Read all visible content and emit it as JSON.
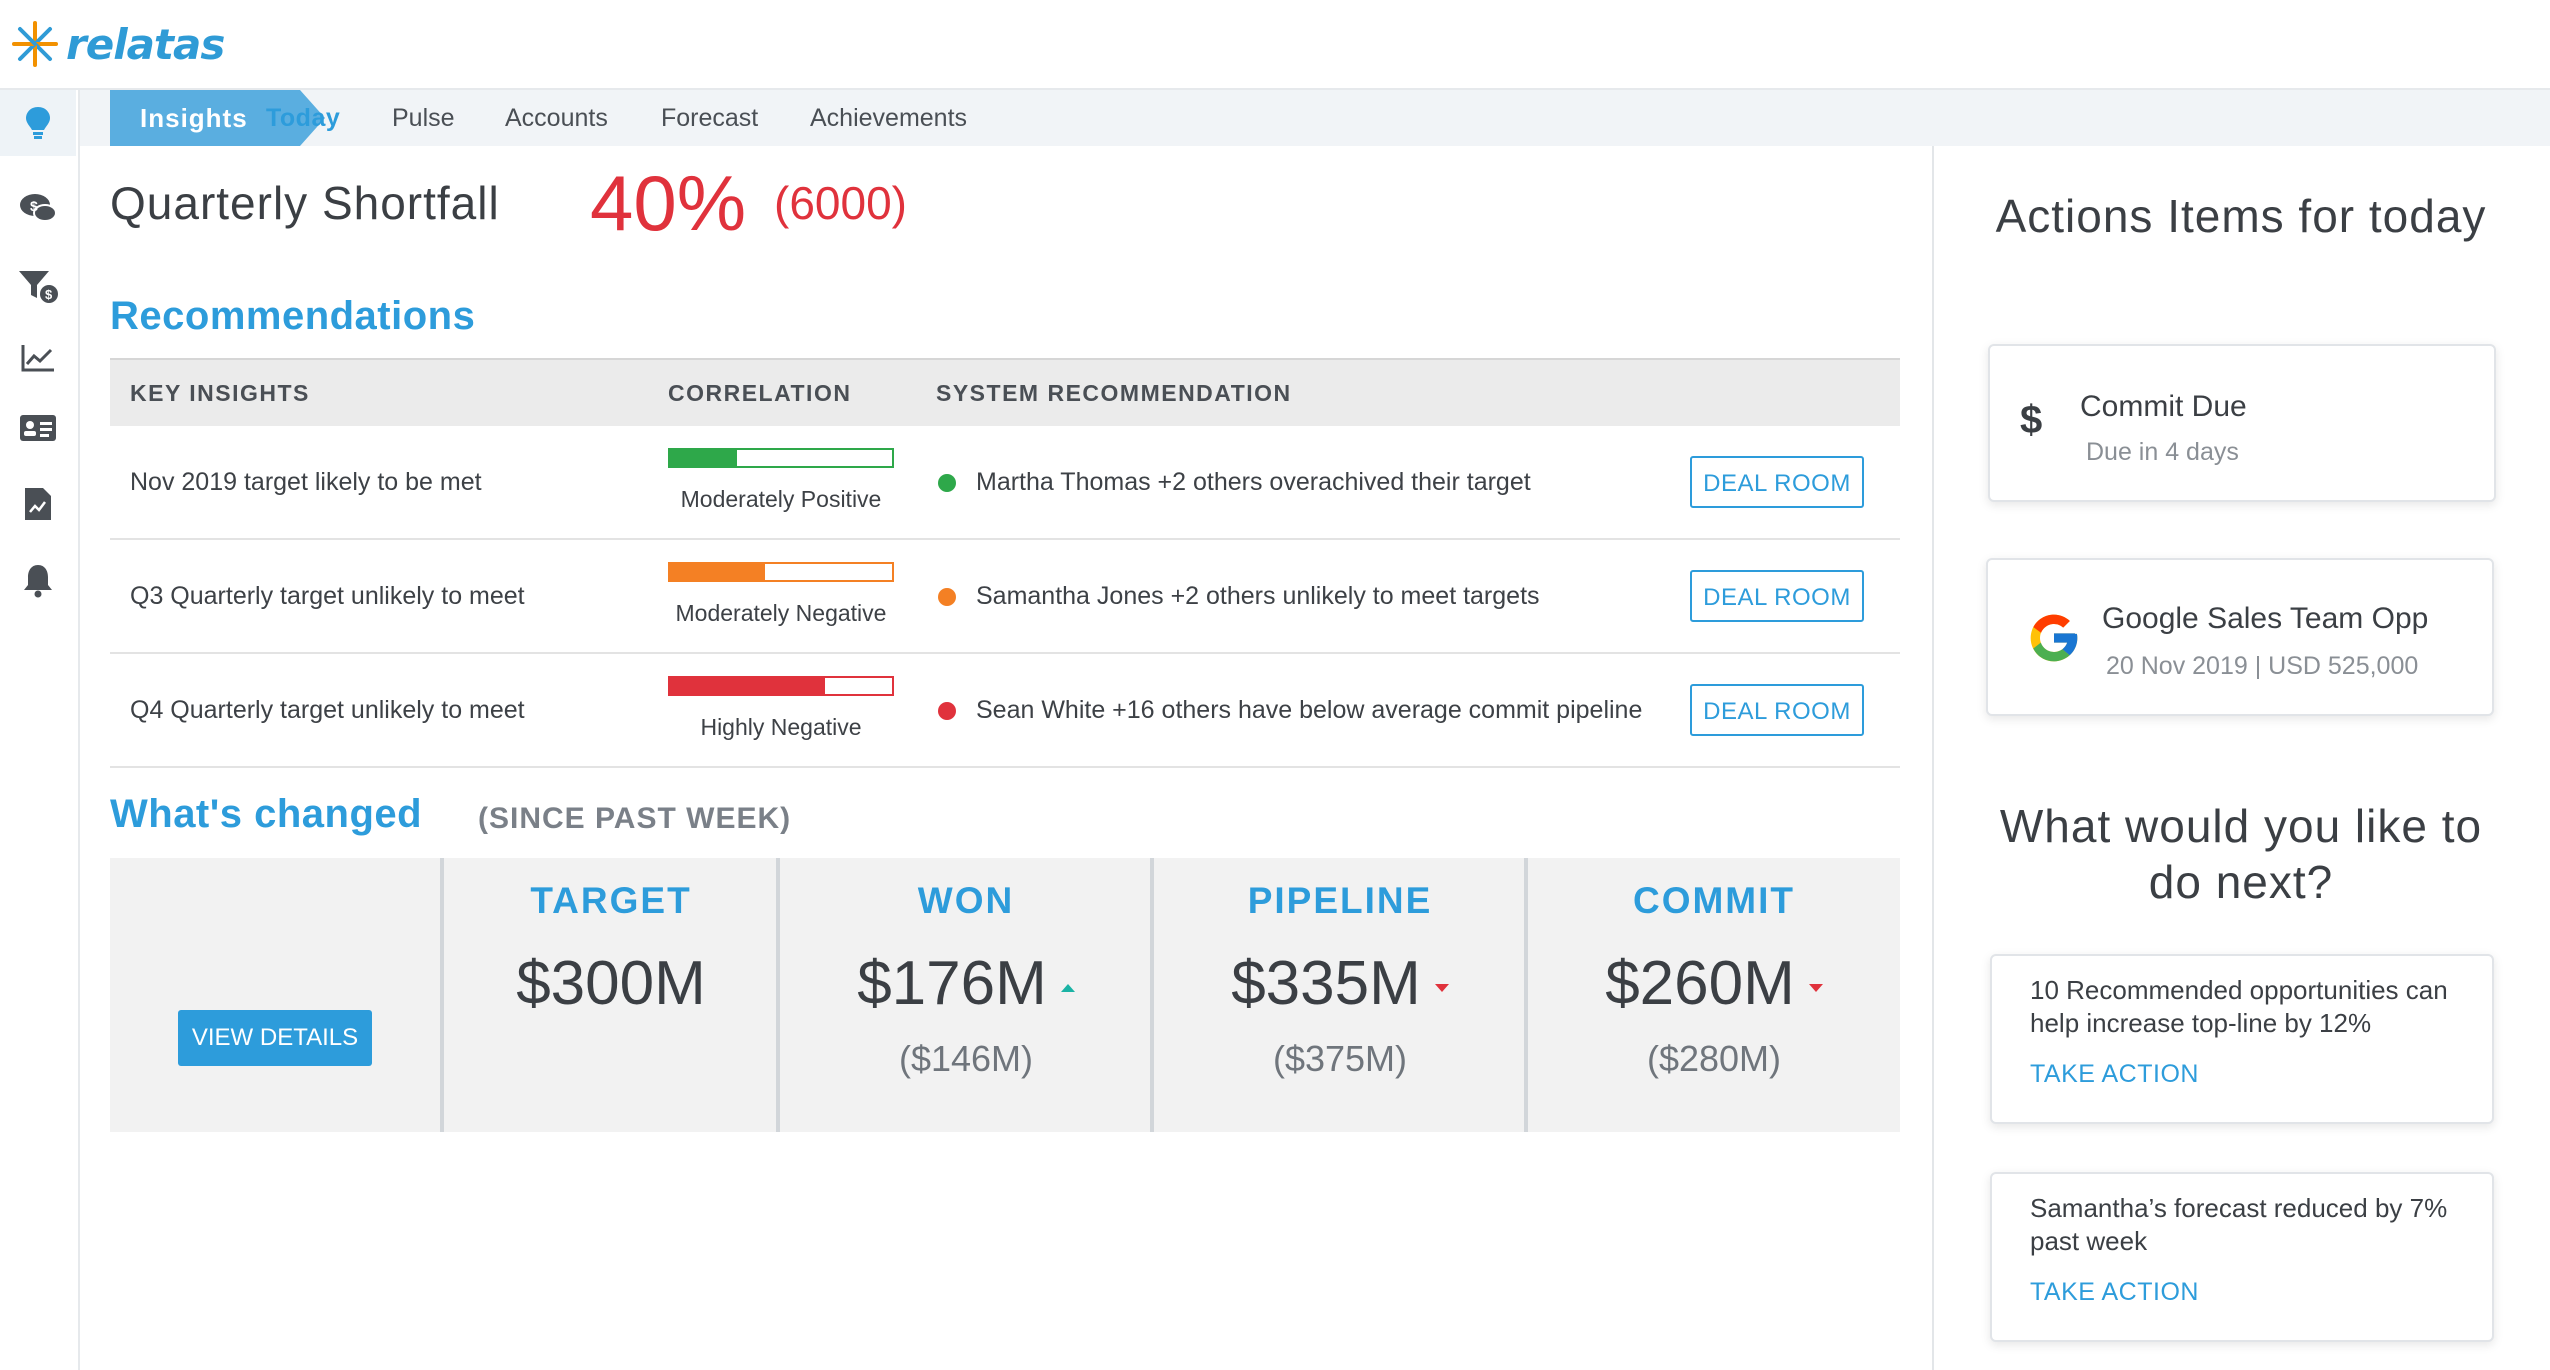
{
  "app": {
    "logo_text": "relatas"
  },
  "tabs": {
    "active_section": "Insights",
    "items": [
      "Today",
      "Pulse",
      "Accounts",
      "Forecast",
      "Achievements"
    ]
  },
  "sidebar": {
    "icons": [
      "lightbulb-icon",
      "chat-dollar-icon",
      "funnel-dollar-icon",
      "line-chart-icon",
      "contact-card-icon",
      "report-icon",
      "bell-icon"
    ]
  },
  "shortfall": {
    "label": "Quarterly Shortfall",
    "percent": "40%",
    "amount": "(6000)"
  },
  "recommendations": {
    "title": "Recommendations",
    "headers": {
      "insights": "KEY INSIGHTS",
      "correlation": "CORRELATION",
      "system": "SYSTEM RECOMMENDATION"
    },
    "rows": [
      {
        "insight": "Nov 2019 target likely to be met",
        "correlation_label": "Moderately Positive",
        "correlation_level": 0.3,
        "color": "#2ea84a",
        "recommendation": "Martha Thomas +2 others overachived their target",
        "button": "DEAL ROOM"
      },
      {
        "insight": "Q3 Quarterly target unlikely to meet",
        "correlation_label": "Moderately Negative",
        "correlation_level": 0.43,
        "color": "#f48024",
        "recommendation": "Samantha Jones +2 others unlikely to meet targets",
        "button": "DEAL ROOM"
      },
      {
        "insight": "Q4 Quarterly target unlikely to meet",
        "correlation_label": "Highly Negative",
        "correlation_level": 0.7,
        "color": "#e0323c",
        "recommendation": "Sean White +16 others have below average commit pipeline",
        "button": "DEAL ROOM"
      }
    ]
  },
  "whats_changed": {
    "title": "What's changed",
    "subtitle": "(SINCE PAST WEEK)",
    "view_details": "VIEW DETAILS",
    "stats": [
      {
        "label": "TARGET",
        "value": "$300M",
        "previous": "",
        "trend": "none"
      },
      {
        "label": "WON",
        "value": "$176M",
        "previous": "($146M)",
        "trend": "up"
      },
      {
        "label": "PIPELINE",
        "value": "$335M",
        "previous": "($375M)",
        "trend": "down"
      },
      {
        "label": "COMMIT",
        "value": "$260M",
        "previous": "($280M)",
        "trend": "down"
      }
    ]
  },
  "right_panel": {
    "actions_title": "Actions Items for today",
    "action_items": [
      {
        "icon": "dollar-icon",
        "title": "Commit Due",
        "subtitle": "Due in 4 days"
      },
      {
        "icon": "google-icon",
        "title": "Google Sales Team Opp",
        "subtitle": "20 Nov 2019 | USD 525,000"
      }
    ],
    "next_title": "What would you like to do next?",
    "suggestions": [
      {
        "text": "10 Recommended opportunities can help increase top-line by 12%",
        "action": "TAKE ACTION"
      },
      {
        "text": "Samantha’s forecast reduced by 7% past week",
        "action": "TAKE ACTION"
      }
    ]
  }
}
